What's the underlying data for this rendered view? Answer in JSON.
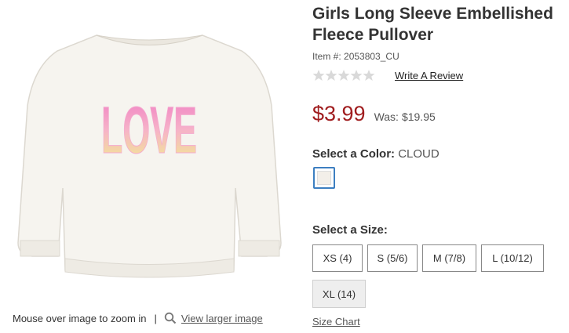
{
  "product": {
    "title": "Girls Long Sleeve Embellished Fleece Pullover",
    "item_number": "Item #: 2053803_CU",
    "write_review": "Write A Review",
    "rating_stars": 0,
    "sale_price": "$3.99",
    "was_label": "Was:",
    "was_price": "$19.95",
    "graphic_text": "LOVE"
  },
  "color": {
    "label": "Select a Color:",
    "selected": "CLOUD",
    "swatch_hex": "#f3efe9"
  },
  "size": {
    "label": "Select a Size:",
    "options": [
      "XS (4)",
      "S (5/6)",
      "M (7/8)",
      "L (10/12)",
      "XL (14)"
    ],
    "chart_link": "Size Chart"
  },
  "image": {
    "zoom_hint": "Mouse over image to zoom in",
    "separator": "|",
    "larger_link": "View larger image"
  },
  "colors": {
    "price_red": "#a01d1f",
    "swatch_border": "#3d7fc1"
  }
}
